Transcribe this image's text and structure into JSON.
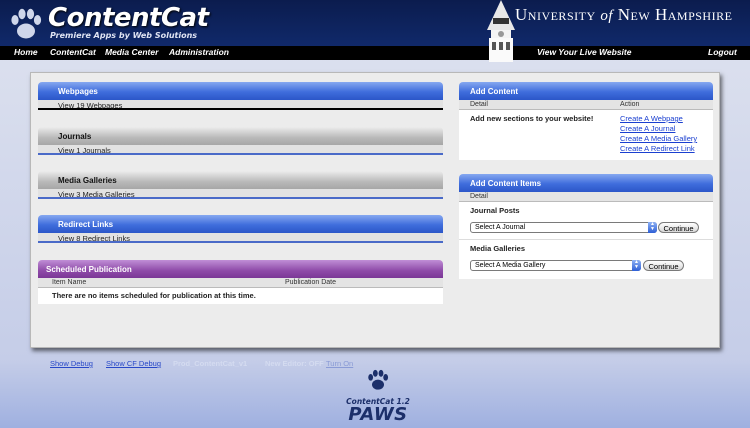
{
  "header": {
    "app_title": "ContentCat",
    "tagline": "Premiere Apps by Web Solutions",
    "university": {
      "part1": "University",
      "part2": "of",
      "part3": "New Hampshire"
    },
    "brand_color": "#10296a"
  },
  "nav": {
    "items": [
      "Home",
      "ContentCat",
      "Media Center",
      "Administration"
    ],
    "live_site": "View Your Live Website",
    "logout": "Logout"
  },
  "left": {
    "webpages": {
      "title": "Webpages",
      "link": "View 19 Webpages"
    },
    "journals": {
      "title": "Journals",
      "link": "View 1 Journals"
    },
    "media": {
      "title": "Media Galleries",
      "link": "View 3 Media Galleries"
    },
    "redirects": {
      "title": "Redirect Links",
      "link": "View 8 Redirect Links"
    },
    "scheduled": {
      "title": "Scheduled Publication",
      "col_name": "Item Name",
      "col_date": "Publication Date",
      "empty": "There are no items scheduled for publication at this time."
    }
  },
  "right": {
    "add_content": {
      "title": "Add Content",
      "col_detail": "Detail",
      "col_action": "Action",
      "detail_text": "Add new sections to your website!",
      "actions": [
        "Create A Webpage",
        "Create A Journal",
        "Create A Media Gallery",
        "Create A Redirect Link"
      ]
    },
    "add_items": {
      "title": "Add Content Items",
      "col_detail": "Detail",
      "journal_label": "Journal Posts",
      "journal_select": "Select A Journal",
      "media_label": "Media Galleries",
      "media_select": "Select A Media Gallery",
      "continue": "Continue"
    }
  },
  "footer": {
    "show_debug": "Show Debug",
    "show_cf_debug": "Show CF Debug",
    "prod": "Prod_ContentCat_v1",
    "new_editor": "New Editor: OFF",
    "turn_on": "Turn On",
    "paws_version": "ContentCat 1.2",
    "paws": "PAWS"
  }
}
